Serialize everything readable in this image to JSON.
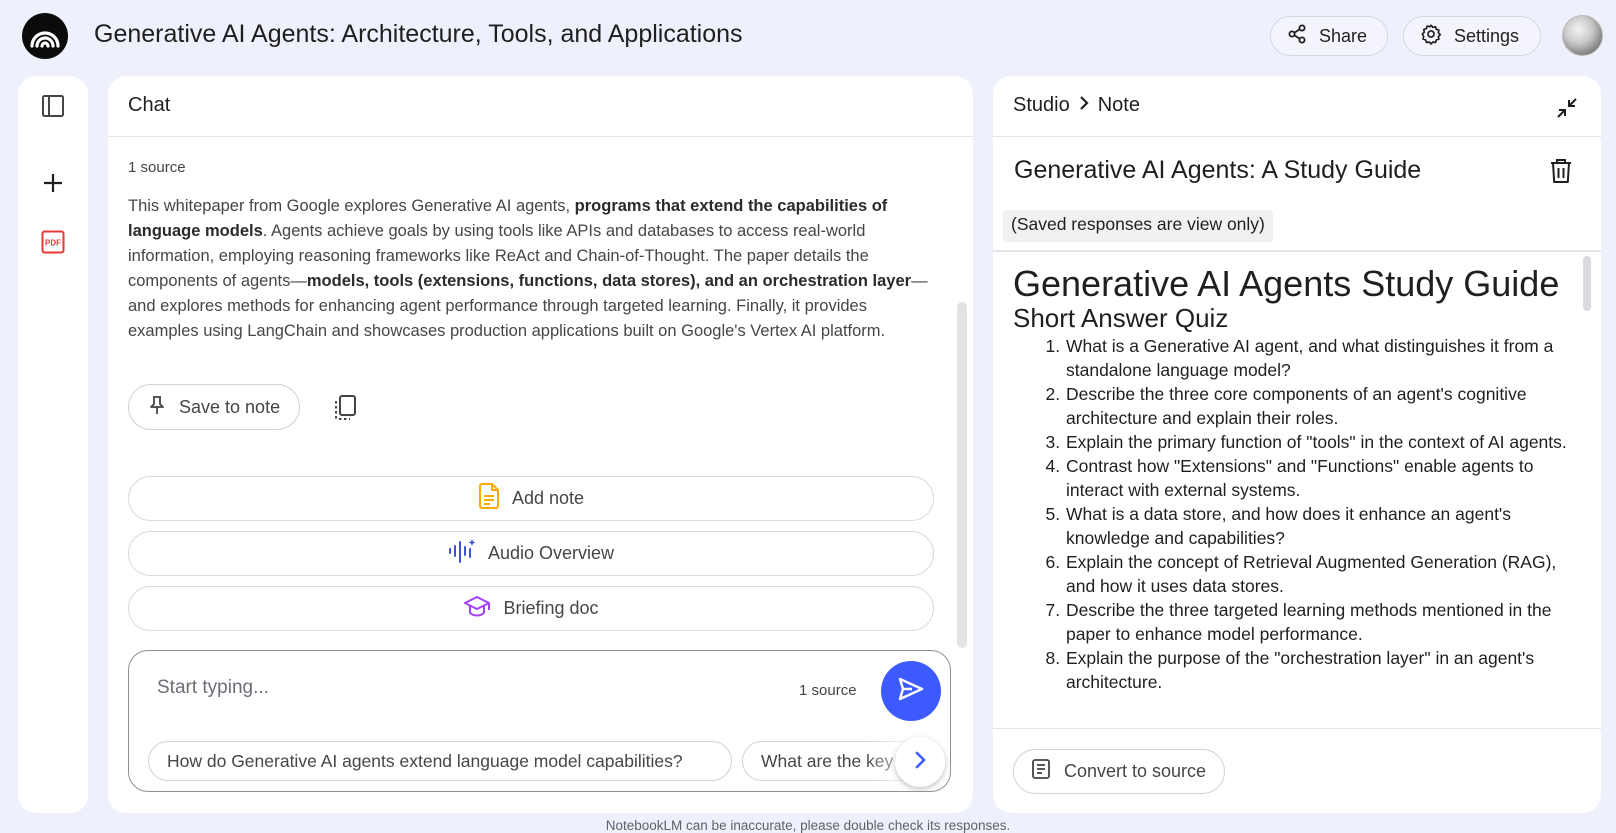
{
  "header": {
    "title": "Generative AI Agents: Architecture, Tools, and Applications",
    "share_label": "Share",
    "settings_label": "Settings"
  },
  "chat": {
    "header": "Chat",
    "source_count": "1 source",
    "summary": {
      "p1": "This whitepaper from Google explores Generative AI agents, ",
      "b1": "programs that extend the capabilities of language models",
      "p2": ". Agents achieve goals by using tools like APIs and databases to access real-world information, employing reasoning frameworks like ReAct and Chain-of-Thought. The paper details the components of agents—",
      "b2": "models, tools (extensions, functions, data stores), and an orchestration layer",
      "p3": "—and explores methods for enhancing agent performance through targeted learning. Finally, it provides examples using LangChain and showcases production applications built on Google's Vertex AI platform."
    },
    "save_to_note": "Save to note",
    "add_note": "Add note",
    "audio_overview": "Audio Overview",
    "briefing_doc": "Briefing doc",
    "composer": {
      "placeholder": "Start typing...",
      "source_count": "1 source",
      "suggestions": [
        "How do Generative AI agents extend language model capabilities?",
        "What are the key"
      ]
    }
  },
  "studio": {
    "crumb_root": "Studio",
    "crumb_current": "Note",
    "note_title": "Generative AI Agents: A Study Guide",
    "view_only_notice": "(Saved responses are view only)",
    "guide_title": "Generative AI Agents Study Guide",
    "section_title": "Short Answer Quiz",
    "questions": [
      "What is a Generative AI agent, and what distinguishes it from a standalone language model?",
      "Describe the three core components of an agent's cognitive architecture and explain their roles.",
      "Explain the primary function of \"tools\" in the context of AI agents.",
      "Contrast how \"Extensions\" and \"Functions\" enable agents to interact with external systems.",
      "What is a data store, and how does it enhance an agent's knowledge and capabilities?",
      "Explain the concept of Retrieval Augmented Generation (RAG), and how it uses data stores.",
      "Describe the three targeted learning methods mentioned in the paper to enhance model performance.",
      "Explain the purpose of the \"orchestration layer\" in an agent's architecture."
    ],
    "convert_to_source": "Convert to source"
  },
  "footer": {
    "disclaimer": "NotebookLM can be inaccurate, please double check its responses."
  },
  "colors": {
    "background": "#eef0fb",
    "send_button": "#3d5afe",
    "add_note_icon": "#f9ab00",
    "audio_icon": "#3f51d8",
    "briefing_icon": "#a142f4",
    "pdf_icon": "#e53935"
  },
  "icons": {
    "logo": "notebooklm-logo-icon",
    "share": "share-icon",
    "settings": "gear-icon",
    "panel_toggle": "sidebar-toggle-icon",
    "add_source": "plus-icon",
    "pdf_source": "pdf-icon",
    "pin": "pin-icon",
    "copy": "copy-icon",
    "send": "send-icon",
    "next": "chevron-right-icon",
    "collapse": "collapse-icon",
    "trash": "trash-icon",
    "convert": "convert-icon"
  }
}
